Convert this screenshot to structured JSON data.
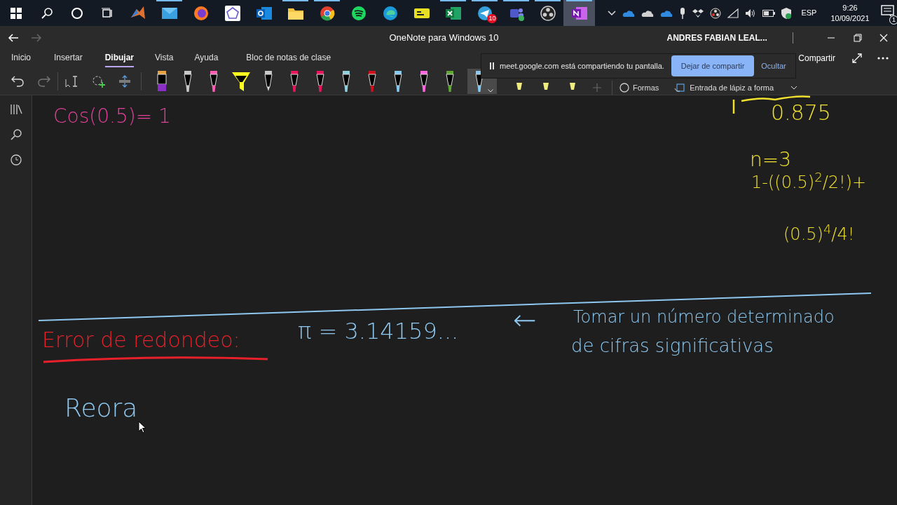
{
  "taskbar": {
    "apps": [
      {
        "kind": "matlab",
        "running": false
      },
      {
        "kind": "mail",
        "running": true
      },
      {
        "kind": "firefox",
        "running": false
      },
      {
        "kind": "geogebra",
        "running": false
      },
      {
        "kind": "outlook",
        "running": false
      },
      {
        "kind": "folder",
        "running": true
      },
      {
        "kind": "chrome",
        "running": true
      },
      {
        "kind": "spotify",
        "running": false
      },
      {
        "kind": "edge",
        "running": false
      },
      {
        "kind": "pdf",
        "running": false
      },
      {
        "kind": "excel",
        "running": true
      },
      {
        "kind": "telegram",
        "running": true,
        "badge": "10"
      },
      {
        "kind": "teams",
        "running": true
      },
      {
        "kind": "obs",
        "running": true
      },
      {
        "kind": "onenote",
        "running": true,
        "selected": true
      }
    ],
    "language": "ESP",
    "time": "9:26",
    "date": "10/09/2021",
    "notifications": "1"
  },
  "window": {
    "title": "OneNote para Windows 10",
    "user": "ANDRES FABIAN LEAL..."
  },
  "tabs": [
    {
      "label": "Inicio",
      "selected": false
    },
    {
      "label": "Insertar",
      "selected": false
    },
    {
      "label": "Dibujar",
      "selected": true
    },
    {
      "label": "Vista",
      "selected": false
    },
    {
      "label": "Ayuda",
      "selected": false
    },
    {
      "label": "Bloc de notas de clase",
      "selected": false
    }
  ],
  "share_button": "Compartir",
  "pens": [
    {
      "kind": "marker",
      "color": "#8a2fc4",
      "selected": false
    },
    {
      "kind": "pen",
      "color": "#c8c8c8",
      "selected": false
    },
    {
      "kind": "pen",
      "color": "#ff5ab4",
      "selected": false
    },
    {
      "kind": "highlighter",
      "color": "#ffff20",
      "selected": false
    },
    {
      "kind": "pencil",
      "color": "#c8c8c8",
      "selected": false
    },
    {
      "kind": "pen",
      "color": "#e8175d",
      "selected": false
    },
    {
      "kind": "pen",
      "color": "#e8175d",
      "selected": false
    },
    {
      "kind": "pen",
      "color": "#8fd0dc",
      "selected": false
    },
    {
      "kind": "pen",
      "color": "#d0101c",
      "selected": false
    },
    {
      "kind": "pen",
      "color": "#86c9f0",
      "selected": false
    },
    {
      "kind": "pen",
      "color": "#ff66e0",
      "selected": false
    },
    {
      "kind": "pen",
      "color": "#5ea832",
      "selected": false
    },
    {
      "kind": "pen",
      "color": "#86c9f0",
      "selected": true
    },
    {
      "kind": "small",
      "color": "#f0ec80",
      "selected": false
    },
    {
      "kind": "small",
      "color": "#f0ec80",
      "selected": false
    },
    {
      "kind": "small",
      "color": "#f0ec80",
      "selected": false
    }
  ],
  "shapes_label": "Formas",
  "ink_to_shape_label": "Entrada de lápiz a forma",
  "share_banner": {
    "message": "meet.google.com está compartiendo tu pantalla.",
    "stop_button": "Dejar de compartir",
    "hide_button": "Ocultar"
  },
  "ink": [
    {
      "text": "Cos(0.5)= 1",
      "color": "#e0409a"
    },
    {
      "text": "0.875",
      "color": "#f0e030"
    },
    {
      "text": "n=3",
      "color": "#f0e030"
    },
    {
      "text": "1-((0.5)$^{2}$/2!)+",
      "color": "#f0e030"
    },
    {
      "text": "(0.5)$^{4}$/4!",
      "color": "#f0e030"
    },
    {
      "text": "Error de redondeo:",
      "color": "#e8202a"
    },
    {
      "text": "π = 3.14159...",
      "color": "#8ec8f0"
    },
    {
      "text": "←",
      "color": "#8ec8f0"
    },
    {
      "text": "Tomar un número determinado",
      "color": "#8ec8f0"
    },
    {
      "text": "de cifras significativas",
      "color": "#8ec8f0"
    },
    {
      "text": "Reora",
      "color": "#8ec8f0"
    }
  ]
}
